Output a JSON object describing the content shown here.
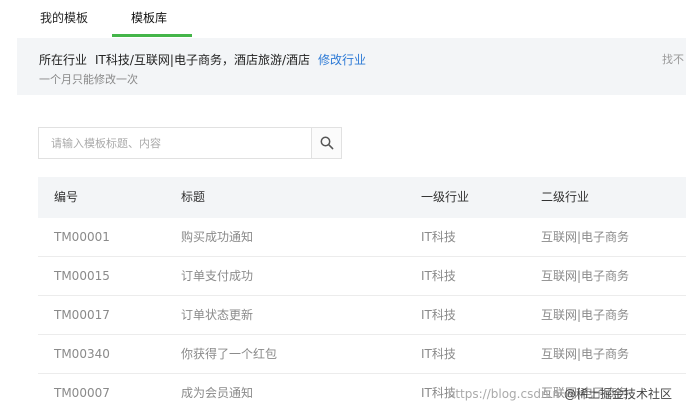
{
  "tabs": [
    {
      "label": "我的模板",
      "active": false
    },
    {
      "label": "模板库",
      "active": true
    }
  ],
  "accent_color": "#44b549",
  "link_color": "#2d7ad6",
  "industry": {
    "label": "所在行业",
    "value": "IT科技/互联网|电子商务，酒店旅游/酒店",
    "modify_link": "修改行业",
    "note": "一个月只能修改一次",
    "right_text": "找不"
  },
  "search": {
    "placeholder": "请输入模板标题、内容",
    "value": "",
    "icon": "search-icon"
  },
  "table": {
    "headers": [
      "编号",
      "标题",
      "一级行业",
      "二级行业"
    ],
    "rows": [
      {
        "id": "TM00001",
        "title": "购买成功通知",
        "level1": "IT科技",
        "level2": "互联网|电子商务"
      },
      {
        "id": "TM00015",
        "title": "订单支付成功",
        "level1": "IT科技",
        "level2": "互联网|电子商务"
      },
      {
        "id": "TM00017",
        "title": "订单状态更新",
        "level1": "IT科技",
        "level2": "互联网|电子商务"
      },
      {
        "id": "TM00340",
        "title": "你获得了一个红包",
        "level1": "IT科技",
        "level2": "互联网|电子商务"
      },
      {
        "id": "TM00007",
        "title": "成为会员通知",
        "level1": "IT科技",
        "level2": "互联网|电子商务"
      }
    ]
  },
  "watermark": {
    "url": "https://blog.csdn.n",
    "text": "@稀土掘金技术社区"
  }
}
